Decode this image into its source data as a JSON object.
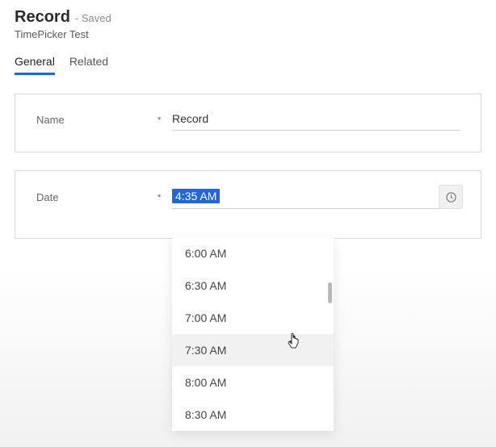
{
  "header": {
    "title": "Record",
    "status": "- Saved",
    "subtitle": "TimePicker Test"
  },
  "tabs": [
    {
      "label": "General",
      "active": true
    },
    {
      "label": "Related",
      "active": false
    }
  ],
  "fields": {
    "name": {
      "label": "Name",
      "required": "*",
      "value": "Record"
    },
    "date": {
      "label": "Date",
      "required": "*",
      "value": "4:35 AM"
    }
  },
  "timepicker": {
    "options": [
      "6:00 AM",
      "6:30 AM",
      "7:00 AM",
      "7:30 AM",
      "8:00 AM",
      "8:30 AM"
    ],
    "hovered_index": 3
  },
  "icons": {
    "clock": "clock"
  }
}
